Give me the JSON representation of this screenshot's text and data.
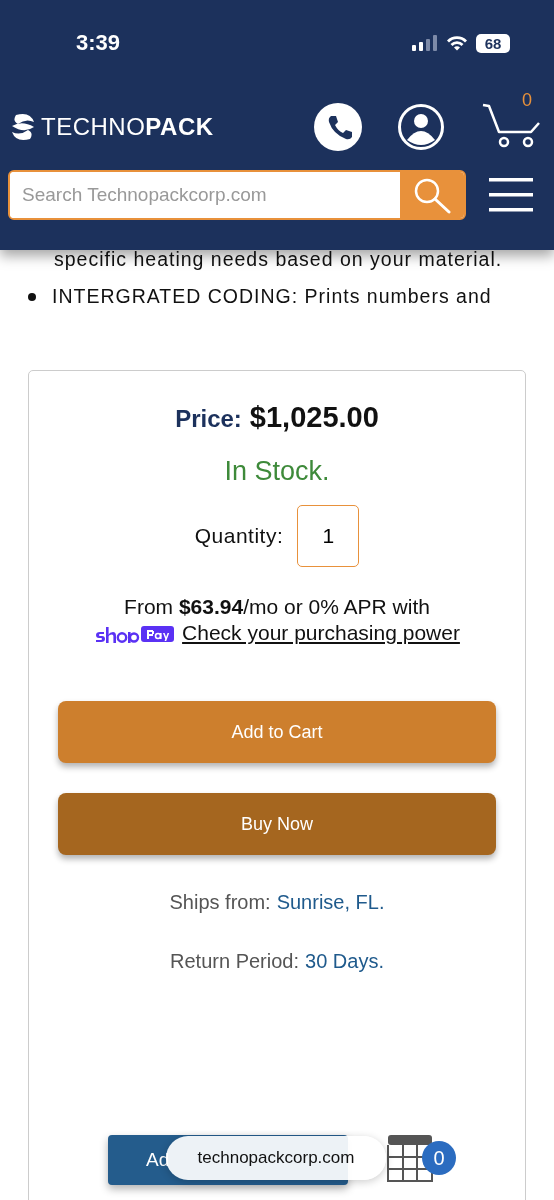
{
  "status_bar": {
    "time": "3:39",
    "battery": "68"
  },
  "header": {
    "logo": "TECHNO**PACK**",
    "cart_count": "0",
    "search": {
      "placeholder": "Search Technopackcorp.com"
    }
  },
  "description": {
    "continued": "specific heating needs based on your material.",
    "bullets": [
      "INTERGRATED CODING: Prints numbers and"
    ]
  },
  "purchase": {
    "price_label": "Price:",
    "price": "$1,025.00",
    "stock": "In Stock.",
    "quantity_label": "Quantity:",
    "quantity": "1",
    "financing": "From **$63.94**/mo or 0% APR with",
    "shop_pay_link": "Check your purchasing power",
    "buttons": [
      {
        "label": "Add to Cart",
        "kind": "primary"
      },
      {
        "label": "Buy Now",
        "kind": "secondary"
      }
    ],
    "details": [
      {
        "label": "Ships from:",
        "value": "Sunrise, FL."
      },
      {
        "label": "Return Period:",
        "value": "30 Days."
      }
    ]
  },
  "sticky_bar": {
    "button": "Ad",
    "badge": "0"
  },
  "browser": {
    "url": "technopackcorp.com"
  }
}
